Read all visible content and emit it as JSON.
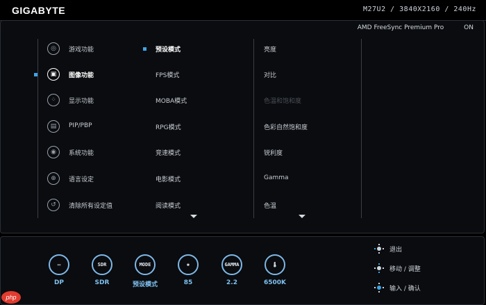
{
  "header": {
    "brand": "GIGABYTE",
    "model": "M27U2 / 3840X2160 / 240Hz"
  },
  "freesync": {
    "label": "AMD FreeSync Premium Pro",
    "value": "ON"
  },
  "menu_col1": [
    {
      "label": "游戏功能",
      "icon": "gamepad-icon",
      "glyph": "◎"
    },
    {
      "label": "图像功能",
      "icon": "picture-icon",
      "glyph": "▣",
      "active": true
    },
    {
      "label": "显示功能",
      "icon": "display-icon",
      "glyph": "⁘"
    },
    {
      "label": "PIP/PBP",
      "icon": "pip-icon",
      "glyph": "▤"
    },
    {
      "label": "系统功能",
      "icon": "system-icon",
      "glyph": "◉"
    },
    {
      "label": "语言设定",
      "icon": "globe-icon",
      "glyph": "⊕"
    },
    {
      "label": "清除所有设定值",
      "icon": "reset-icon",
      "glyph": "↺"
    }
  ],
  "menu_col2": [
    {
      "label": "预设模式",
      "active": true
    },
    {
      "label": "FPS模式"
    },
    {
      "label": "MOBA模式"
    },
    {
      "label": "RPG模式"
    },
    {
      "label": "竞速模式"
    },
    {
      "label": "电影模式"
    },
    {
      "label": "阅读模式"
    }
  ],
  "menu_col3": [
    {
      "label": "亮度"
    },
    {
      "label": "对比"
    },
    {
      "label": "色温和饱和度",
      "dim": true
    },
    {
      "label": "色彩自然饱和度"
    },
    {
      "label": "锐利度"
    },
    {
      "label": "Gamma"
    },
    {
      "label": "色温"
    }
  ],
  "status": [
    {
      "icon": "input-icon",
      "glyph": "▭",
      "value": "DP"
    },
    {
      "icon": "sdr-icon",
      "glyph": "SDR",
      "value": "SDR"
    },
    {
      "icon": "mode-icon",
      "glyph": "MODE",
      "value": "预设模式"
    },
    {
      "icon": "brightness-icon",
      "glyph": "✺",
      "value": "85"
    },
    {
      "icon": "gamma-icon",
      "glyph": "GAMMA",
      "value": "2.2"
    },
    {
      "icon": "temperature-icon",
      "glyph": "🌡",
      "value": "6500K"
    }
  ],
  "nav_hints": [
    {
      "label": "退出",
      "dir": "left"
    },
    {
      "label": "移动 / 调整",
      "dir": "up"
    },
    {
      "label": "输入 / 确认",
      "dir": "center"
    }
  ],
  "watermark": "php"
}
